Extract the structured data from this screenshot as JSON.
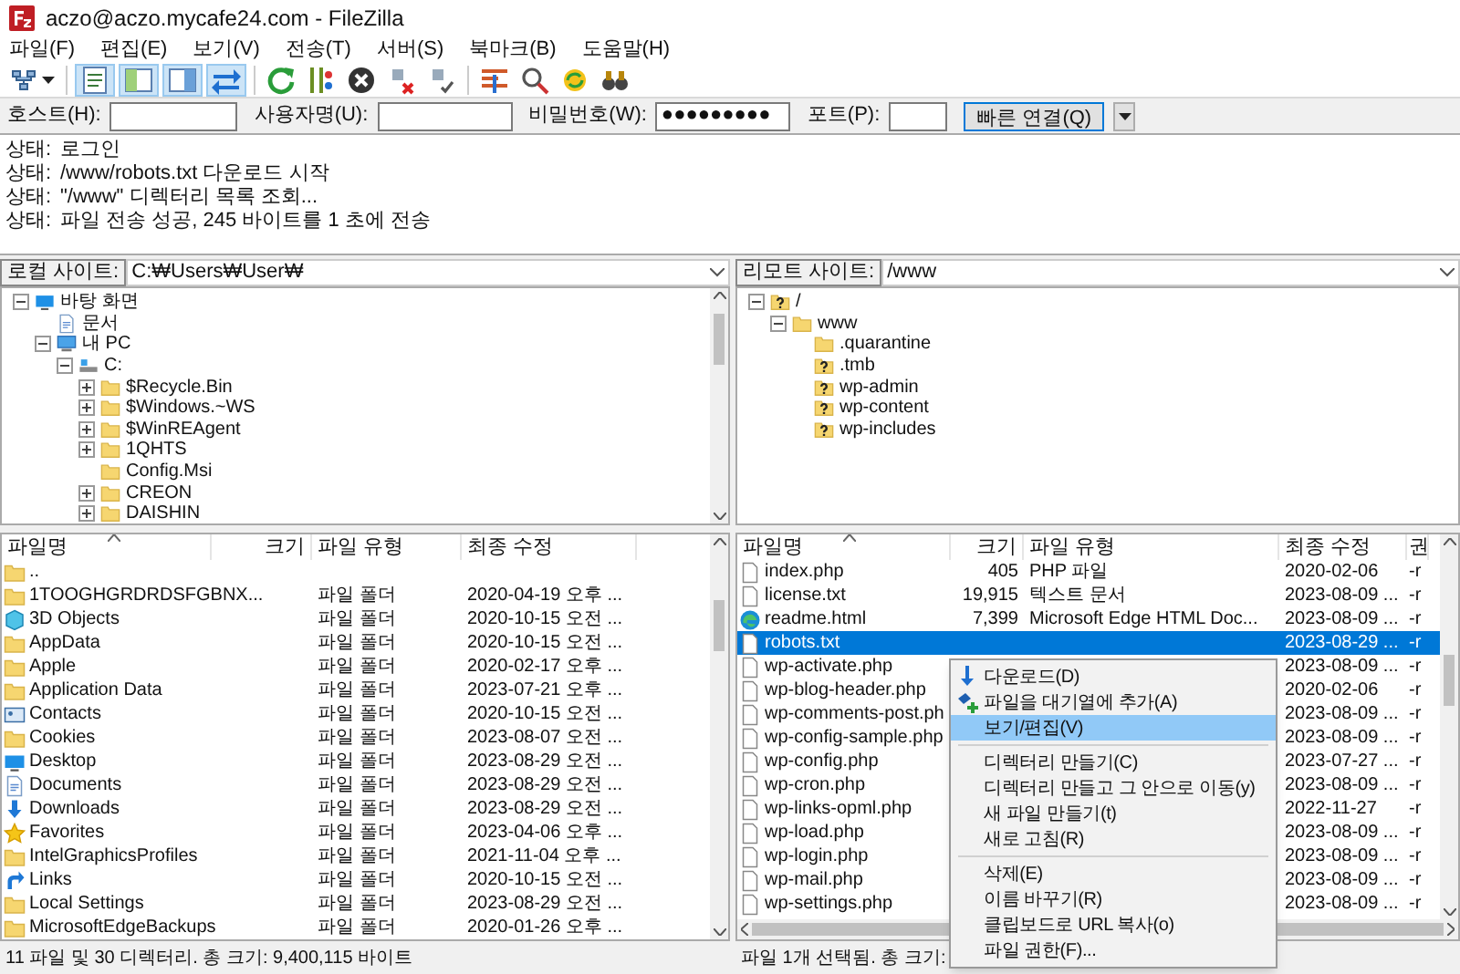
{
  "window": {
    "title": "aczo@aczo.mycafe24.com - FileZilla"
  },
  "menu": [
    "파일(F)",
    "편집(E)",
    "보기(V)",
    "전송(T)",
    "서버(S)",
    "북마크(B)",
    "도움말(H)"
  ],
  "toolbar": {
    "view_toggles": [
      {
        "on": true
      },
      {
        "on": true
      },
      {
        "on": true
      },
      {
        "on": true
      }
    ]
  },
  "quickconnect": {
    "fields": [
      {
        "label": "호스트(H):"
      },
      {
        "label": "사용자명(U):"
      },
      {
        "label": "비밀번호(W):",
        "value": "●●●●●●●●●"
      },
      {
        "label": "포트(P):"
      }
    ],
    "button": "빠른 연결(Q)"
  },
  "log": [
    {
      "label": "상태:",
      "message": "로그인"
    },
    {
      "label": "상태:",
      "message": "/www/robots.txt 다운로드 시작"
    },
    {
      "label": "상태:",
      "message": "\"/www\" 디렉터리 목록 조회..."
    },
    {
      "label": "상태:",
      "message": "파일 전송 성공, 245 바이트를 1 초에 전송"
    }
  ],
  "local": {
    "site_label": "로컬 사이트:",
    "path": "C:₩Users₩User₩",
    "tree": [
      {
        "name": "바탕 화면",
        "kind": "desktop",
        "expanded": true,
        "children": [
          {
            "name": "문서",
            "kind": "document"
          },
          {
            "name": "내 PC",
            "kind": "pc",
            "expanded": true,
            "children": [
              {
                "name": "C:",
                "kind": "drive",
                "expanded": true,
                "children": [
                  {
                    "name": "$Recycle.Bin",
                    "kind": "folder",
                    "expanded": false
                  },
                  {
                    "name": "$Windows.~WS",
                    "kind": "folder",
                    "expanded": false
                  },
                  {
                    "name": "$WinREAgent",
                    "kind": "folder",
                    "expanded": false
                  },
                  {
                    "name": "1QHTS",
                    "kind": "folder",
                    "expanded": false
                  },
                  {
                    "name": "Config.Msi",
                    "kind": "folder"
                  },
                  {
                    "name": "CREON",
                    "kind": "folder",
                    "expanded": false
                  },
                  {
                    "name": "DAISHIN",
                    "kind": "folder",
                    "expanded": false
                  }
                ]
              }
            ]
          }
        ]
      }
    ],
    "columns": [
      "파일명",
      "크기",
      "파일 유형",
      "최종 수정"
    ],
    "rows": [
      {
        "name": "..",
        "kind": "folder",
        "selected": false
      },
      {
        "name": "1TOOGHGRDRDSFGBNX...",
        "kind": "folder",
        "type": "파일 폴더",
        "date": "2020-04-19 오후 ...",
        "selected": false
      },
      {
        "name": "3D Objects",
        "kind": "cube",
        "type": "파일 폴더",
        "date": "2020-10-15 오전 ...",
        "selected": false
      },
      {
        "name": "AppData",
        "kind": "folder",
        "type": "파일 폴더",
        "date": "2020-10-15 오전 ...",
        "selected": false
      },
      {
        "name": "Apple",
        "kind": "folder",
        "type": "파일 폴더",
        "date": "2020-02-17 오후 ...",
        "selected": false
      },
      {
        "name": "Application Data",
        "kind": "folder",
        "type": "파일 폴더",
        "date": "2023-07-21 오후 ...",
        "selected": false
      },
      {
        "name": "Contacts",
        "kind": "contacts",
        "type": "파일 폴더",
        "date": "2020-10-15 오전 ...",
        "selected": false
      },
      {
        "name": "Cookies",
        "kind": "folder",
        "type": "파일 폴더",
        "date": "2023-08-07 오전 ...",
        "selected": false
      },
      {
        "name": "Desktop",
        "kind": "desktop",
        "type": "파일 폴더",
        "date": "2023-08-29 오전 ...",
        "selected": false
      },
      {
        "name": "Documents",
        "kind": "document",
        "type": "파일 폴더",
        "date": "2023-08-29 오전 ...",
        "selected": false
      },
      {
        "name": "Downloads",
        "kind": "downloads",
        "type": "파일 폴더",
        "date": "2023-08-29 오전 ...",
        "selected": false
      },
      {
        "name": "Favorites",
        "kind": "favorites",
        "type": "파일 폴더",
        "date": "2023-04-06 오후 ...",
        "selected": false
      },
      {
        "name": "IntelGraphicsProfiles",
        "kind": "folder",
        "type": "파일 폴더",
        "date": "2021-11-04 오후 ...",
        "selected": false
      },
      {
        "name": "Links",
        "kind": "links",
        "type": "파일 폴더",
        "date": "2020-10-15 오전 ...",
        "selected": false
      },
      {
        "name": "Local Settings",
        "kind": "folder",
        "type": "파일 폴더",
        "date": "2023-08-29 오전 ...",
        "selected": false
      },
      {
        "name": "MicrosoftEdgeBackups",
        "kind": "folder",
        "type": "파일 폴더",
        "date": "2020-01-26 오후 ...",
        "selected": false
      }
    ],
    "status": "11 파일 및 30 디렉터리. 총 크기: 9,400,115 바이트"
  },
  "remote": {
    "site_label": "리모트 사이트:",
    "path": "/www",
    "tree": [
      {
        "name": "/",
        "kind": "unknown",
        "expanded": true,
        "children": [
          {
            "name": "www",
            "kind": "folder",
            "expanded": true,
            "children": [
              {
                "name": ".quarantine",
                "kind": "folder"
              },
              {
                "name": ".tmb",
                "kind": "unknown"
              },
              {
                "name": "wp-admin",
                "kind": "unknown"
              },
              {
                "name": "wp-content",
                "kind": "unknown"
              },
              {
                "name": "wp-includes",
                "kind": "unknown"
              }
            ]
          }
        ]
      }
    ],
    "columns": [
      "파일명",
      "크기",
      "파일 유형",
      "최종 수정",
      "권"
    ],
    "rows": [
      {
        "name": "index.php",
        "kind": "file",
        "size": "405",
        "type": "PHP 파일",
        "date": "2020-02-06",
        "perm": "-r",
        "selected": false
      },
      {
        "name": "license.txt",
        "kind": "file",
        "size": "19,915",
        "type": "텍스트 문서",
        "date": "2023-08-09 ...",
        "perm": "-r",
        "selected": false
      },
      {
        "name": "readme.html",
        "kind": "browser",
        "size": "7,399",
        "type": "Microsoft Edge HTML Doc...",
        "date": "2023-08-09 ...",
        "perm": "-r",
        "selected": false
      },
      {
        "name": "robots.txt",
        "kind": "file",
        "date": "2023-08-29 ...",
        "perm": "-r",
        "selected": true
      },
      {
        "name": "wp-activate.php",
        "kind": "file",
        "date": "2023-08-09 ...",
        "perm": "-r",
        "selected": false
      },
      {
        "name": "wp-blog-header.php",
        "kind": "file",
        "date": "2020-02-06",
        "perm": "-r",
        "selected": false
      },
      {
        "name": "wp-comments-post.ph",
        "kind": "file",
        "date": "2023-08-09 ...",
        "perm": "-r",
        "selected": false
      },
      {
        "name": "wp-config-sample.php",
        "kind": "file",
        "date": "2023-08-09 ...",
        "perm": "-r",
        "selected": false
      },
      {
        "name": "wp-config.php",
        "kind": "file",
        "date": "2023-07-27 ...",
        "perm": "-r",
        "selected": false
      },
      {
        "name": "wp-cron.php",
        "kind": "file",
        "date": "2023-08-09 ...",
        "perm": "-r",
        "selected": false
      },
      {
        "name": "wp-links-opml.php",
        "kind": "file",
        "date": "2022-11-27",
        "perm": "-r",
        "selected": false
      },
      {
        "name": "wp-load.php",
        "kind": "file",
        "date": "2023-08-09 ...",
        "perm": "-r",
        "selected": false
      },
      {
        "name": "wp-login.php",
        "kind": "file",
        "date": "2023-08-09 ...",
        "perm": "-r",
        "selected": false
      },
      {
        "name": "wp-mail.php",
        "kind": "file",
        "date": "2023-08-09 ...",
        "perm": "-r",
        "selected": false
      },
      {
        "name": "wp-settings.php",
        "kind": "file",
        "date": "2023-08-09 ...",
        "perm": "-r",
        "selected": false
      }
    ],
    "status": "파일 1개 선택됨. 총 크기:"
  },
  "context_menu": {
    "items": [
      {
        "kind": "download",
        "label": "다운로드(D)",
        "highlighted": false
      },
      {
        "kind": "queue",
        "label": "파일을 대기열에 추가(A)",
        "highlighted": false
      },
      {
        "kind": "item",
        "label": "보기/편집(V)",
        "highlighted": true
      },
      {
        "kind": "separator"
      },
      {
        "kind": "item",
        "label": "디렉터리 만들기(C)",
        "highlighted": false
      },
      {
        "kind": "item",
        "label": "디렉터리 만들고 그 안으로 이동(y)",
        "highlighted": false
      },
      {
        "kind": "item",
        "label": "새 파일 만들기(t)",
        "highlighted": false
      },
      {
        "kind": "item",
        "label": "새로 고침(R)",
        "highlighted": false
      },
      {
        "kind": "separator"
      },
      {
        "kind": "item",
        "label": "삭제(E)",
        "highlighted": false
      },
      {
        "kind": "item",
        "label": "이름 바꾸기(R)",
        "highlighted": false
      },
      {
        "kind": "item",
        "label": "클립보드로 URL 복사(o)",
        "highlighted": false
      },
      {
        "kind": "item",
        "label": "파일 권한(F)...",
        "highlighted": false
      }
    ]
  }
}
